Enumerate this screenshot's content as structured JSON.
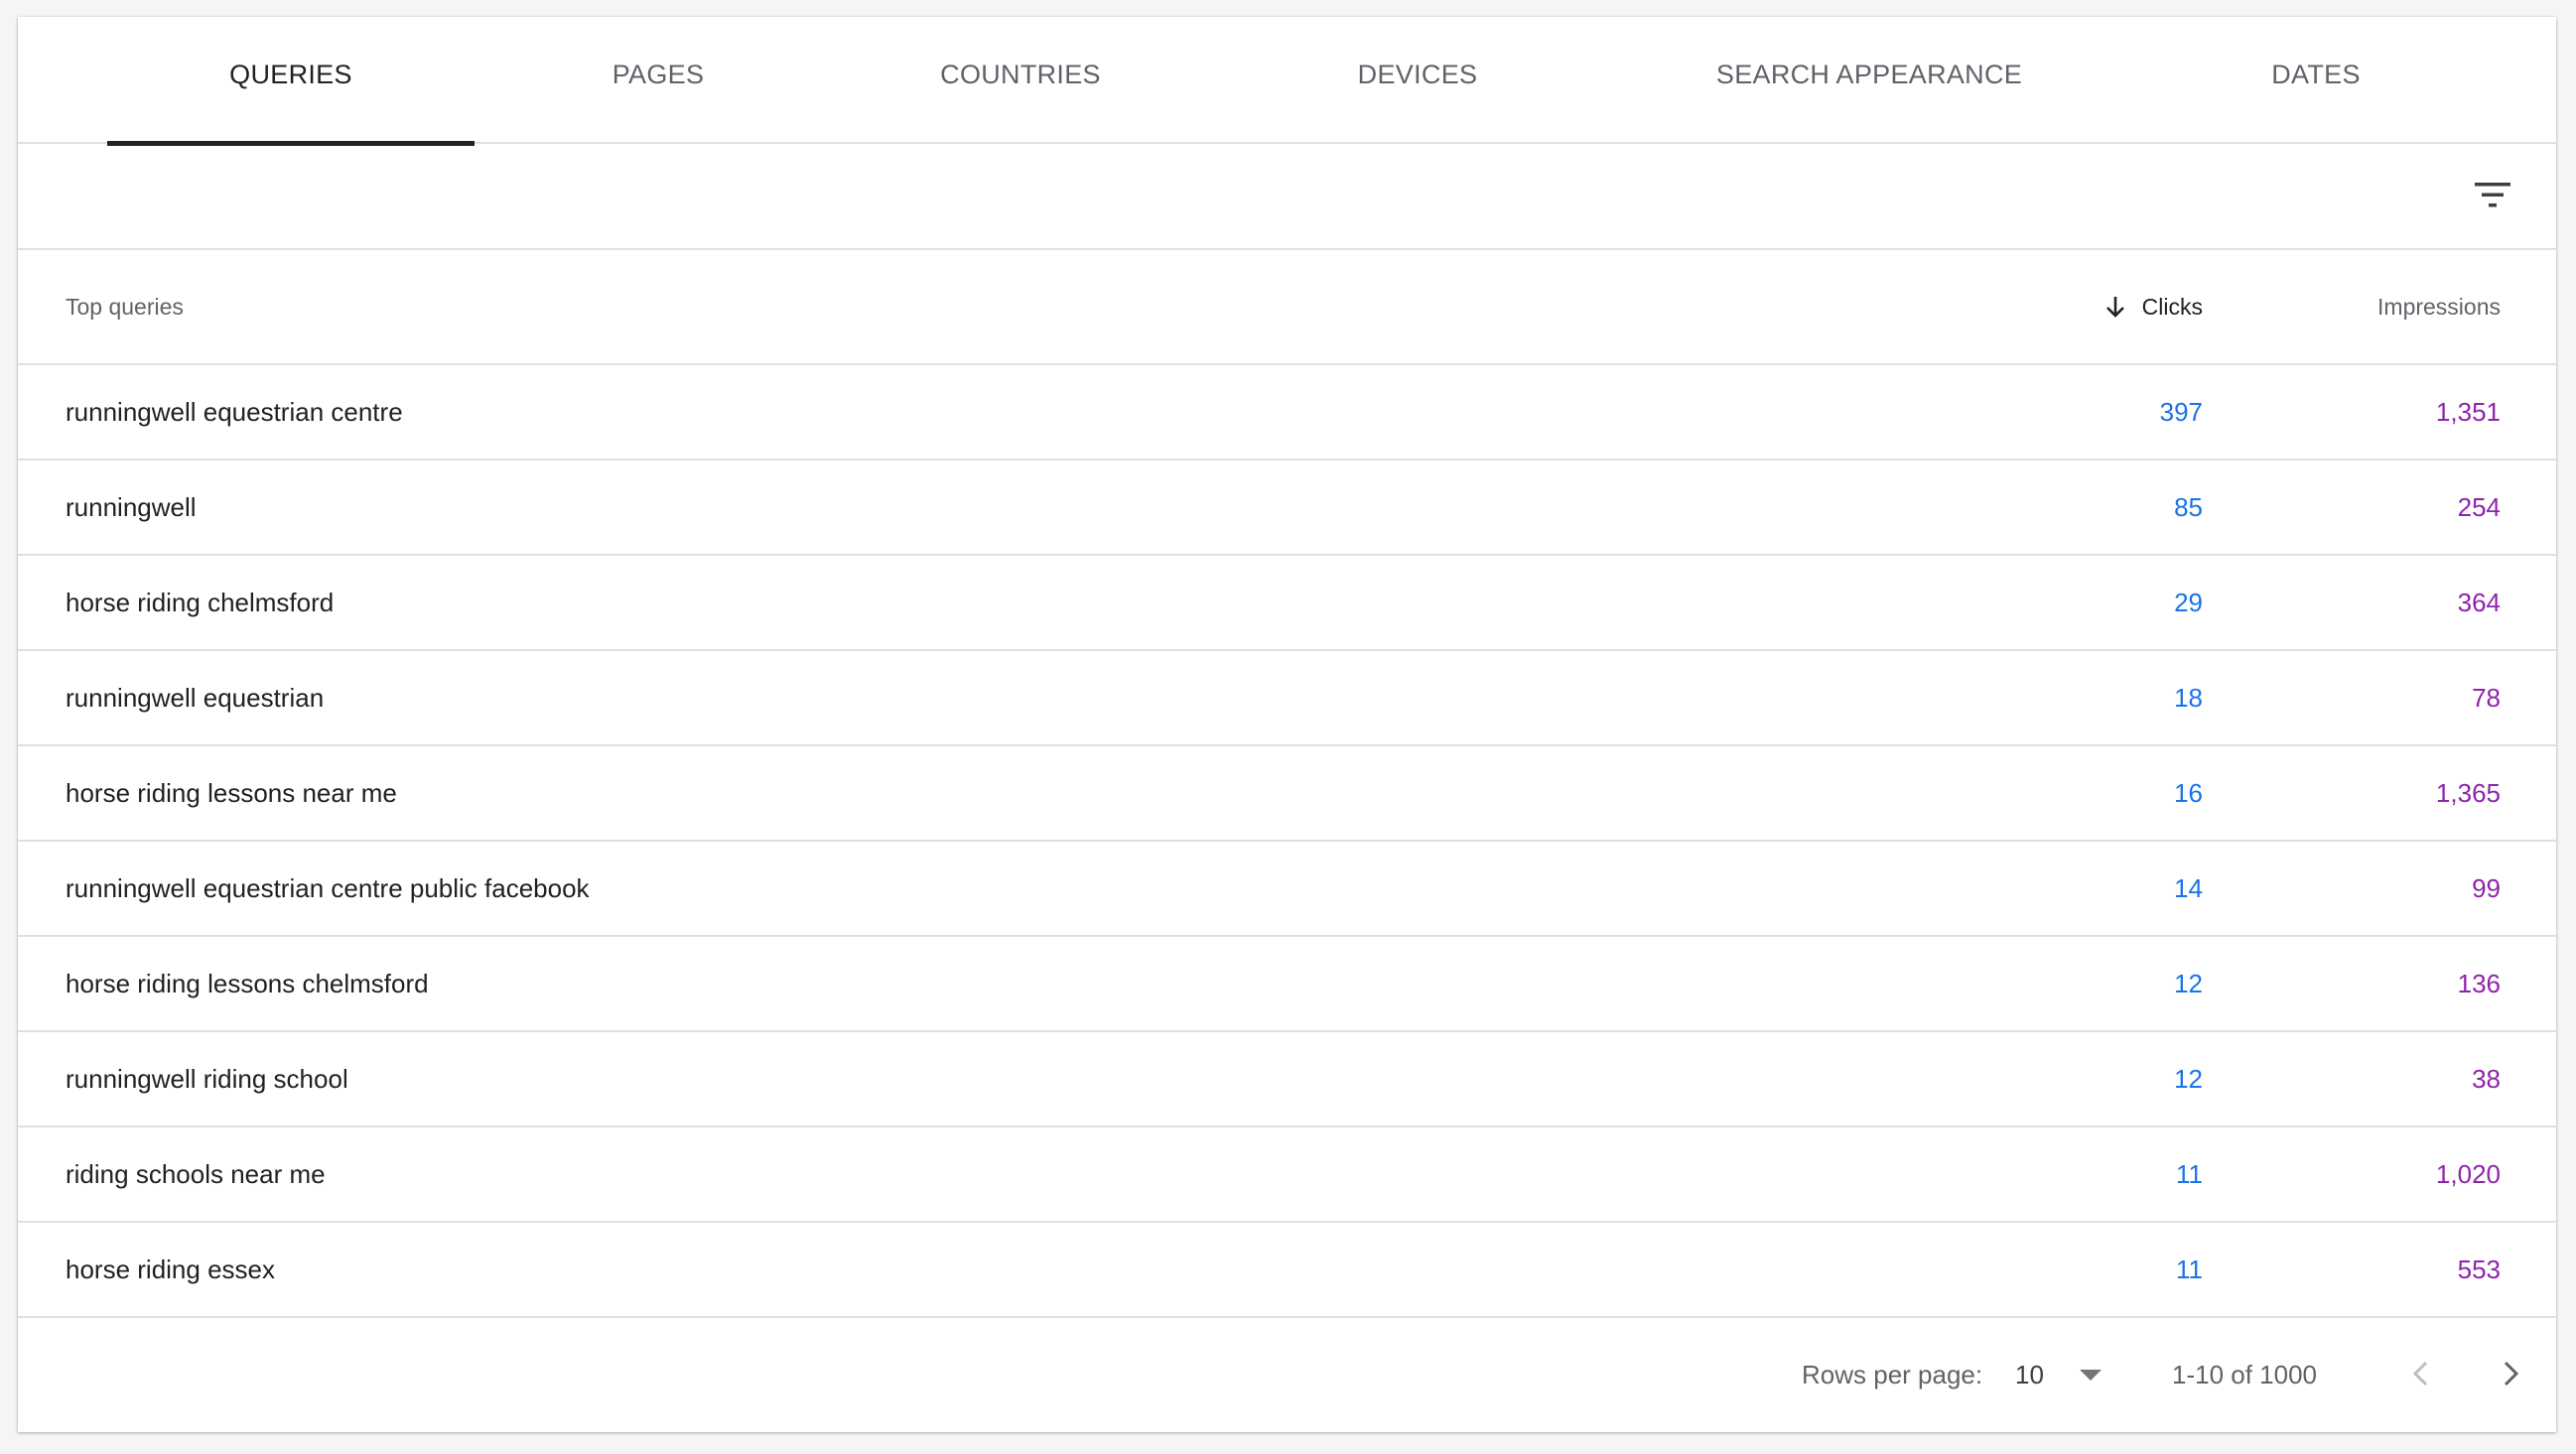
{
  "tabs": [
    {
      "label": "QUERIES",
      "active": true
    },
    {
      "label": "PAGES",
      "active": false
    },
    {
      "label": "COUNTRIES",
      "active": false
    },
    {
      "label": "DEVICES",
      "active": false
    },
    {
      "label": "SEARCH APPEARANCE",
      "active": false
    },
    {
      "label": "DATES",
      "active": false
    }
  ],
  "filter": {
    "icon": "filter-icon"
  },
  "table": {
    "header": {
      "query": "Top queries",
      "clicks": "Clicks",
      "impressions": "Impressions",
      "sort_icon": "arrow-down-icon"
    },
    "rows": [
      {
        "query": "runningwell equestrian centre",
        "clicks": "397",
        "impressions": "1,351"
      },
      {
        "query": "runningwell",
        "clicks": "85",
        "impressions": "254"
      },
      {
        "query": "horse riding chelmsford",
        "clicks": "29",
        "impressions": "364"
      },
      {
        "query": "runningwell equestrian",
        "clicks": "18",
        "impressions": "78"
      },
      {
        "query": "horse riding lessons near me",
        "clicks": "16",
        "impressions": "1,365"
      },
      {
        "query": "runningwell equestrian centre public facebook",
        "clicks": "14",
        "impressions": "99"
      },
      {
        "query": "horse riding lessons chelmsford",
        "clicks": "12",
        "impressions": "136"
      },
      {
        "query": "runningwell riding school",
        "clicks": "12",
        "impressions": "38"
      },
      {
        "query": "riding schools near me",
        "clicks": "11",
        "impressions": "1,020"
      },
      {
        "query": "horse riding essex",
        "clicks": "11",
        "impressions": "553"
      }
    ]
  },
  "pagination": {
    "rows_label": "Rows per page:",
    "rows_value": "10",
    "range": "1-10 of 1000"
  },
  "colors": {
    "clicks": "#1a73e8",
    "impressions": "#8e24aa",
    "active_tab": "#202124"
  }
}
